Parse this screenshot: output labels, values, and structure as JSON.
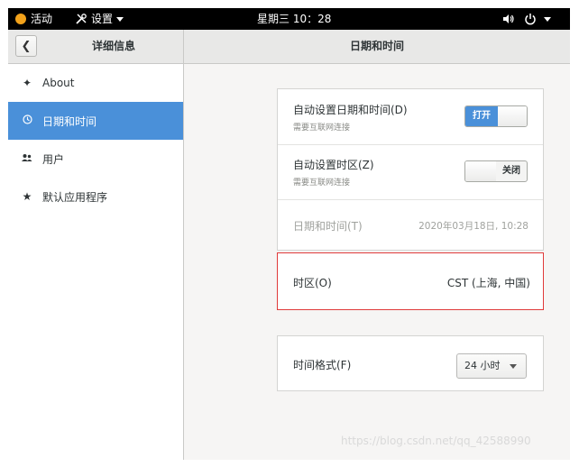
{
  "topbar": {
    "activities": "活动",
    "app_menu": "设置",
    "clock": "星期三 10：28"
  },
  "header": {
    "left_title": "详细信息",
    "main_title": "日期和时间"
  },
  "sidebar": {
    "items": [
      {
        "label": "About",
        "icon": "star-icon"
      },
      {
        "label": "日期和时间",
        "icon": "clock-icon",
        "selected": true
      },
      {
        "label": "用户",
        "icon": "users-icon"
      },
      {
        "label": "默认应用程序",
        "icon": "star-icon"
      }
    ]
  },
  "settings": {
    "auto_datetime": {
      "title": "自动设置日期和时间(D)",
      "subtitle": "需要互联网连接",
      "switch_label": "打开",
      "enabled": true
    },
    "auto_timezone": {
      "title": "自动设置时区(Z)",
      "subtitle": "需要互联网连接",
      "switch_label": "关闭",
      "enabled": false
    },
    "datetime": {
      "label": "日期和时间(T)",
      "value": "2020年03月18日, 10:28"
    },
    "timezone": {
      "label": "时区(O)",
      "value": "CST (上海, 中国)"
    },
    "time_format": {
      "label": "时间格式(F)",
      "value": "24 小时"
    }
  },
  "watermark": "https://blog.csdn.net/qq_42588990",
  "colors": {
    "accent": "#4a90d9",
    "highlight_border": "#e03a3a"
  }
}
